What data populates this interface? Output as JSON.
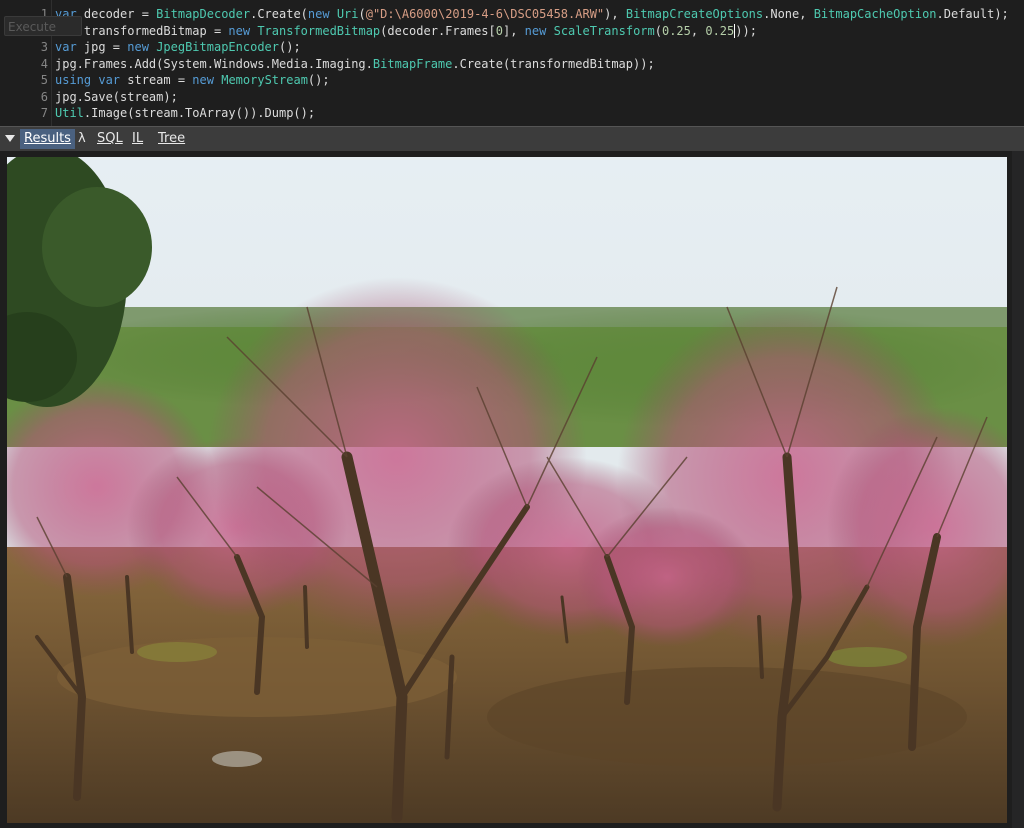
{
  "editor": {
    "execute_overlay": "Execute",
    "line_numbers": [
      "1",
      "2",
      "3",
      "4",
      "5",
      "6",
      "7"
    ],
    "lines": [
      [
        {
          "t": "var",
          "c": "kw"
        },
        {
          "t": " decoder = ",
          "c": "plain"
        },
        {
          "t": "BitmapDecoder",
          "c": "type"
        },
        {
          "t": ".Create(",
          "c": "plain"
        },
        {
          "t": "new",
          "c": "kw"
        },
        {
          "t": " ",
          "c": "plain"
        },
        {
          "t": "Uri",
          "c": "type"
        },
        {
          "t": "(",
          "c": "plain"
        },
        {
          "t": "@\"D:\\A6000\\2019-4-6\\DSC05458.ARW\"",
          "c": "str"
        },
        {
          "t": "), ",
          "c": "plain"
        },
        {
          "t": "BitmapCreateOptions",
          "c": "type"
        },
        {
          "t": ".None, ",
          "c": "plain"
        },
        {
          "t": "BitmapCacheOption",
          "c": "type"
        },
        {
          "t": ".Default);",
          "c": "plain"
        }
      ],
      [
        {
          "t": "var",
          "c": "kw"
        },
        {
          "t": " transformedBitmap = ",
          "c": "plain"
        },
        {
          "t": "new",
          "c": "kw"
        },
        {
          "t": " ",
          "c": "plain"
        },
        {
          "t": "TransformedBitmap",
          "c": "type"
        },
        {
          "t": "(decoder.Frames[",
          "c": "plain"
        },
        {
          "t": "0",
          "c": "num"
        },
        {
          "t": "], ",
          "c": "plain"
        },
        {
          "t": "new",
          "c": "kw"
        },
        {
          "t": " ",
          "c": "plain"
        },
        {
          "t": "ScaleTransform",
          "c": "type"
        },
        {
          "t": "(",
          "c": "plain"
        },
        {
          "t": "0.25",
          "c": "num"
        },
        {
          "t": ", ",
          "c": "plain"
        },
        {
          "t": "0.25",
          "c": "num"
        },
        {
          "t": "CARET",
          "c": "caret"
        },
        {
          "t": "));",
          "c": "plain"
        }
      ],
      [
        {
          "t": "var",
          "c": "kw"
        },
        {
          "t": " jpg = ",
          "c": "plain"
        },
        {
          "t": "new",
          "c": "kw"
        },
        {
          "t": " ",
          "c": "plain"
        },
        {
          "t": "JpegBitmapEncoder",
          "c": "type"
        },
        {
          "t": "();",
          "c": "plain"
        }
      ],
      [
        {
          "t": "jpg.Frames.Add(System.Windows.Media.Imaging.",
          "c": "plain"
        },
        {
          "t": "BitmapFrame",
          "c": "type"
        },
        {
          "t": ".Create(transformedBitmap));",
          "c": "plain"
        }
      ],
      [
        {
          "t": "using",
          "c": "kw"
        },
        {
          "t": " ",
          "c": "plain"
        },
        {
          "t": "var",
          "c": "kw"
        },
        {
          "t": " stream = ",
          "c": "plain"
        },
        {
          "t": "new",
          "c": "kw"
        },
        {
          "t": " ",
          "c": "plain"
        },
        {
          "t": "MemoryStream",
          "c": "type"
        },
        {
          "t": "();",
          "c": "plain"
        }
      ],
      [
        {
          "t": "jpg.Save(stream);",
          "c": "plain"
        }
      ],
      [
        {
          "t": "Util",
          "c": "type"
        },
        {
          "t": ".Image(stream.ToArray()).Dump();",
          "c": "plain"
        }
      ]
    ]
  },
  "results_bar": {
    "collapse_icon": "triangle-down",
    "tabs": [
      {
        "id": "results",
        "label": "Results",
        "active": true
      },
      {
        "id": "lambda",
        "label": "λ",
        "active": false
      },
      {
        "id": "sql",
        "label": "SQL",
        "active": false
      },
      {
        "id": "il",
        "label": "IL",
        "active": false
      },
      {
        "id": "tree",
        "label": "Tree",
        "active": false
      }
    ]
  },
  "results": {
    "image_subject": "peach-blossom-orchard-photo"
  },
  "colors": {
    "editor_bg": "#1e1e1e",
    "keyword": "#569cd6",
    "type": "#4ec9b0",
    "string": "#d69d85",
    "number": "#b5cea8",
    "active_tab": "#4a6180"
  }
}
